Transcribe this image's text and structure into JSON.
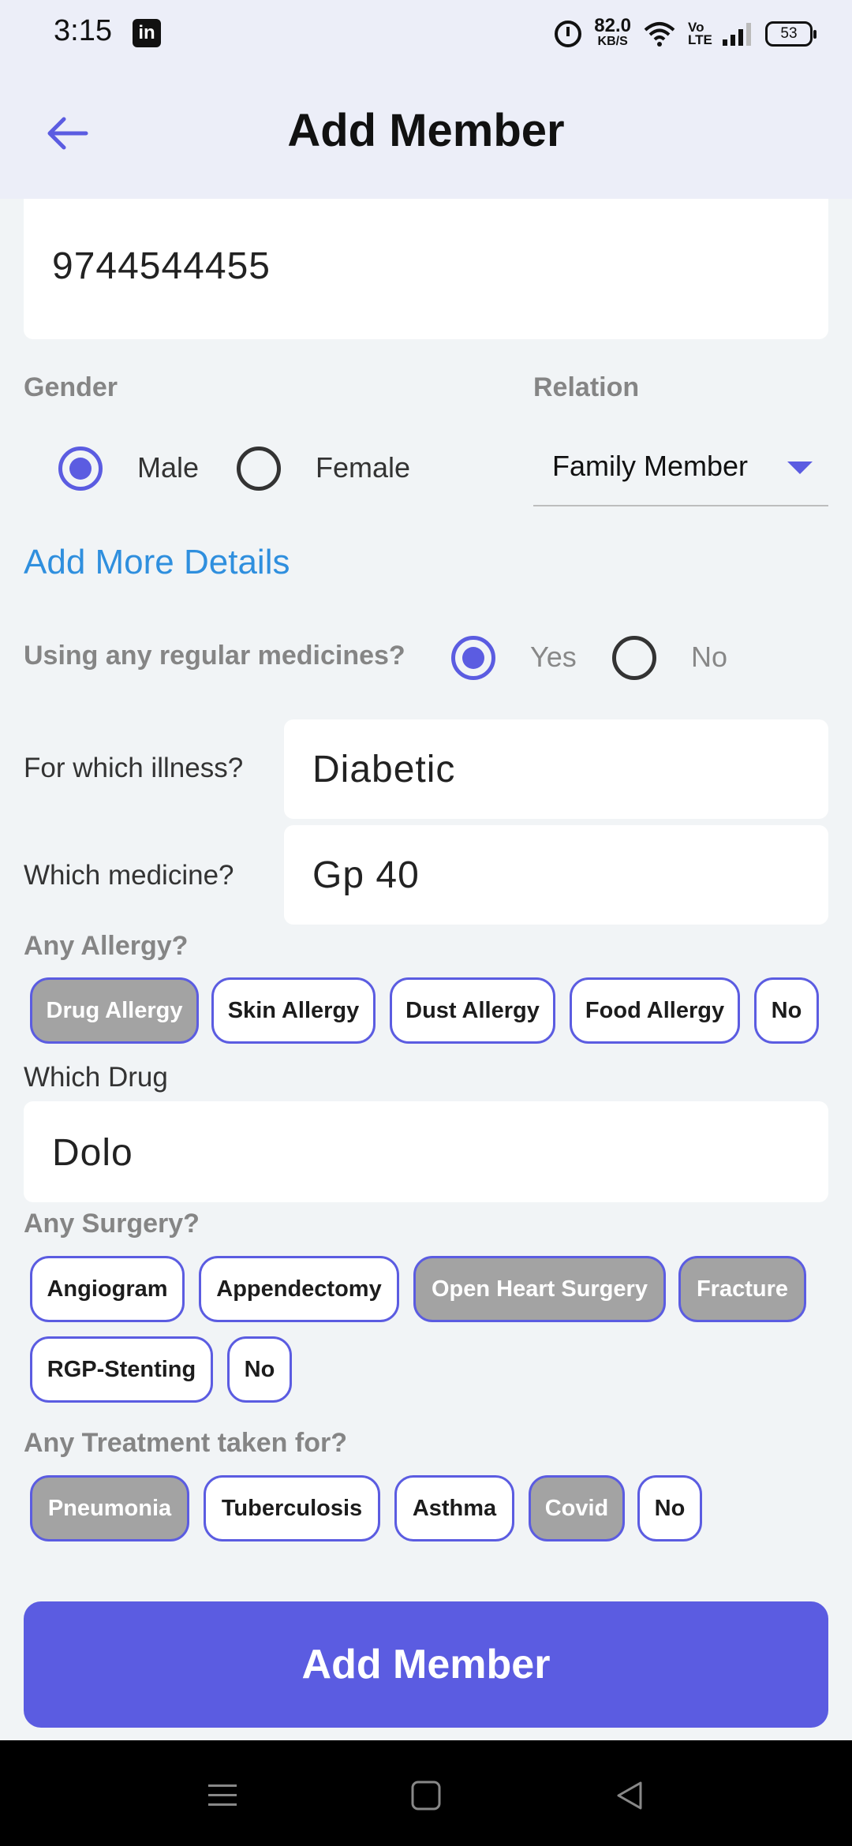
{
  "status_bar": {
    "time": "3:15",
    "speed_value": "82.0",
    "speed_unit": "KB/S",
    "volte": "Vo LTE",
    "battery": "53"
  },
  "header": {
    "title": "Add Member"
  },
  "form": {
    "phone_value": "9744544455",
    "gender_label": "Gender",
    "gender_options": [
      "Male",
      "Female"
    ],
    "gender_selected": "Male",
    "relation_label": "Relation",
    "relation_value": "Family Member",
    "add_more_link": "Add More Details",
    "medicines_question": "Using any regular medicines?",
    "medicines_options": [
      "Yes",
      "No"
    ],
    "medicines_selected": "Yes",
    "illness_label": "For which illness?",
    "illness_value": "Diabetic",
    "medicine_label": "Which medicine?",
    "medicine_value": "Gp 40",
    "allergy_label": "Any Allergy?",
    "allergy_chips": [
      {
        "label": "Drug Allergy",
        "selected": true
      },
      {
        "label": "Skin Allergy",
        "selected": false
      },
      {
        "label": "Dust Allergy",
        "selected": false
      },
      {
        "label": "Food Allergy",
        "selected": false
      },
      {
        "label": "No",
        "selected": false
      }
    ],
    "drug_label": "Which Drug",
    "drug_value": "Dolo",
    "surgery_label": "Any Surgery?",
    "surgery_chips": [
      {
        "label": "Angiogram",
        "selected": false
      },
      {
        "label": "Appendectomy",
        "selected": false
      },
      {
        "label": "Open Heart Surgery",
        "selected": true
      },
      {
        "label": "Fracture",
        "selected": true
      },
      {
        "label": "RGP-Stenting",
        "selected": false
      },
      {
        "label": "No",
        "selected": false
      }
    ],
    "treatment_label": "Any Treatment taken for?",
    "treatment_chips": [
      {
        "label": "Pneumonia",
        "selected": true
      },
      {
        "label": "Tuberculosis",
        "selected": false
      },
      {
        "label": "Asthma",
        "selected": false
      },
      {
        "label": "Covid",
        "selected": true
      },
      {
        "label": "No",
        "selected": false
      }
    ],
    "submit_label": "Add Member"
  },
  "colors": {
    "accent": "#5b5ce1",
    "link": "#2f8fde",
    "chip_selected": "#a3a3a3",
    "background": "#f1f4f6",
    "app_bar": "#eceef8"
  }
}
